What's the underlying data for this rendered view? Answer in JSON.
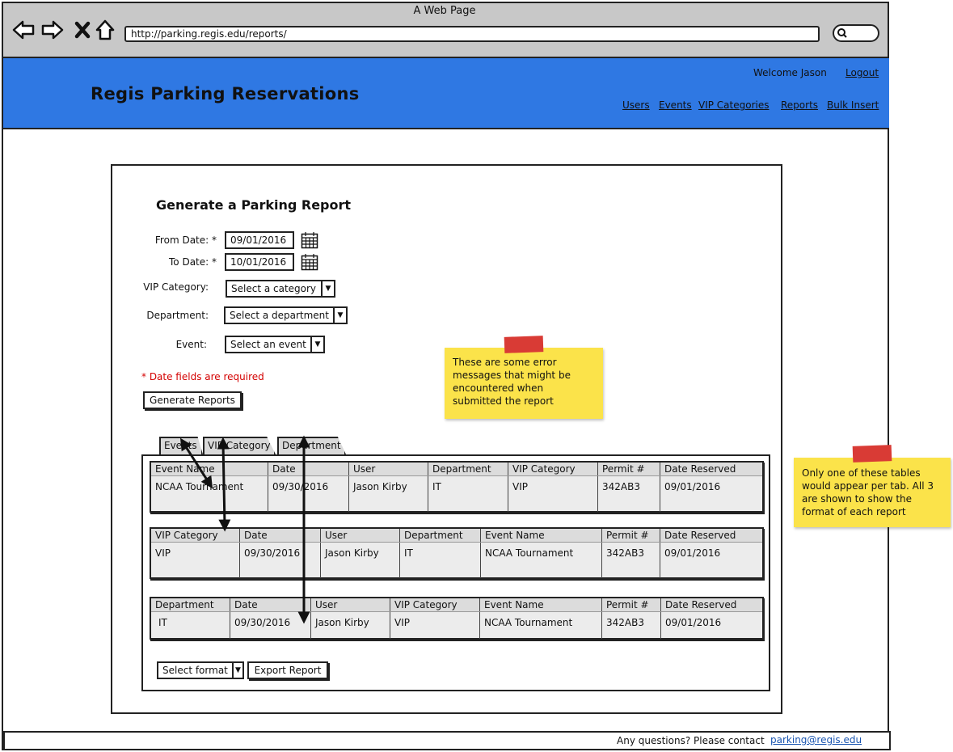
{
  "browser": {
    "window_title": "A Web Page",
    "url": "http://parking.regis.edu/reports/"
  },
  "header": {
    "site_title": "Regis Parking Reservations",
    "welcome": "Welcome Jason",
    "logout": "Logout",
    "nav": [
      "Users",
      "Events",
      "VIP Categories",
      "Reports",
      "Bulk Insert"
    ],
    "background_color": "#2f78e3"
  },
  "form": {
    "heading": "Generate a Parking Report",
    "from_date_label": "From Date: *",
    "from_date_value": "09/01/2016",
    "to_date_label": "To Date: *",
    "to_date_value": "10/01/2016",
    "vip_label": "VIP Category:",
    "vip_value": "Select a category",
    "dept_label": "Department:",
    "dept_value": "Select a department",
    "event_label": "Event:",
    "event_value": "Select an event",
    "required_note": "* Date fields are required",
    "generate_button": "Generate Reports"
  },
  "tabs": [
    "Events",
    "VIP Category",
    "Department"
  ],
  "tables": {
    "events": {
      "headers": [
        "Event Name",
        "Date",
        "User",
        "Department",
        "VIP Category",
        "Permit #",
        "Date Reserved"
      ],
      "row": [
        "NCAA Tournament",
        "09/30/2016",
        "Jason Kirby",
        "IT",
        "VIP",
        "342AB3",
        "09/01/2016"
      ]
    },
    "vip": {
      "headers": [
        "VIP Category",
        "Date",
        "User",
        "Department",
        "Event Name",
        "Permit #",
        "Date Reserved"
      ],
      "row": [
        "VIP",
        "09/30/2016",
        "Jason Kirby",
        "IT",
        "NCAA Tournament",
        "342AB3",
        "09/01/2016"
      ]
    },
    "department": {
      "headers": [
        "Department",
        "Date",
        "User",
        "VIP Category",
        "Event Name",
        "Permit #",
        "Date Reserved"
      ],
      "row": [
        "IT",
        "09/30/2016",
        "Jason Kirby",
        "VIP",
        "NCAA Tournament",
        "342AB3",
        "09/01/2016"
      ]
    }
  },
  "export": {
    "format_select": "Select format",
    "export_button": "Export Report"
  },
  "notes": {
    "error_note": "These are some error messages that might be encountered when submitted the report",
    "tables_note": "Only one of these tables would appear per tab. All 3 are shown to show the format of each report"
  },
  "footer": {
    "text": "Any questions? Please contact",
    "email": "parking@regis.edu"
  }
}
